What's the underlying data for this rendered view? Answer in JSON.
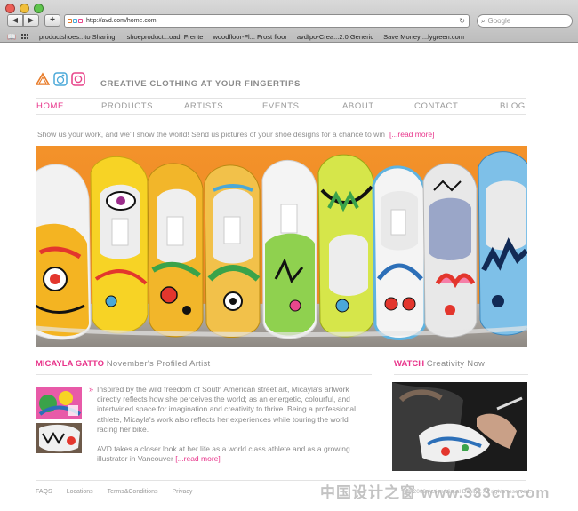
{
  "browser": {
    "url": "http://avd.com/home.com",
    "search_placeholder": "Google",
    "bookmarks": [
      "productshoes...to Sharing!",
      "shoeproduct...oad: Frente",
      "woodfloor-Fl... Frost floor",
      "avdfpo-Crea...2.0 Generic",
      "Save Money ...lygreen.com"
    ]
  },
  "site": {
    "tagline": "CREATIVE CLOTHING AT YOUR FINGERTIPS",
    "nav": [
      "HOME",
      "PRODUCTS",
      "ARTISTS",
      "EVENTS",
      "ABOUT",
      "CONTACT",
      "BLOG"
    ],
    "intro": {
      "text": "Show us your work, and we'll show the world! Send us pictures of your shoe designs for a chance to win",
      "link": "[...read more]"
    },
    "profile": {
      "name": "MICAYLA GATTO",
      "title": "November's Profiled Artist",
      "bullet": "»",
      "paragraph1": "Inspired by the wild freedom of South American street art, Micayla's artwork directly reflects how she perceives the world; as an energetic, colourful, and intertwined space for imagination and creativity to thrive. Being a professional athlete, Micayla's work also reflects her experiences while touring the world racing her bike.",
      "paragraph2": "AVD takes a closer look at her life as a world class athlete and as a growing illustrator in Vancouver",
      "paragraph2_link": "[...read more]"
    },
    "watch": {
      "label": "WATCH",
      "title": "Creativity Now"
    },
    "footer": [
      "FAQS",
      "Locations",
      "Terms&Conditions",
      "Privacy"
    ],
    "copyright": "© 2009 Action Visual Design. All rights reserved.",
    "watermark": "中国设计之窗 www.333cn.com"
  },
  "colors": {
    "accent": "#e8338a",
    "hero_bg": "#f08a24",
    "logo_orange": "#e87c2a",
    "logo_blue": "#4aa8d8",
    "logo_pink": "#e8478c"
  },
  "icons": {
    "back": "back-arrow-icon",
    "forward": "forward-arrow-icon",
    "new_tab": "plus-icon",
    "reload": "reload-icon",
    "search": "search-icon",
    "bookmarks_book": "book-icon",
    "top_sites": "grid-icon"
  }
}
